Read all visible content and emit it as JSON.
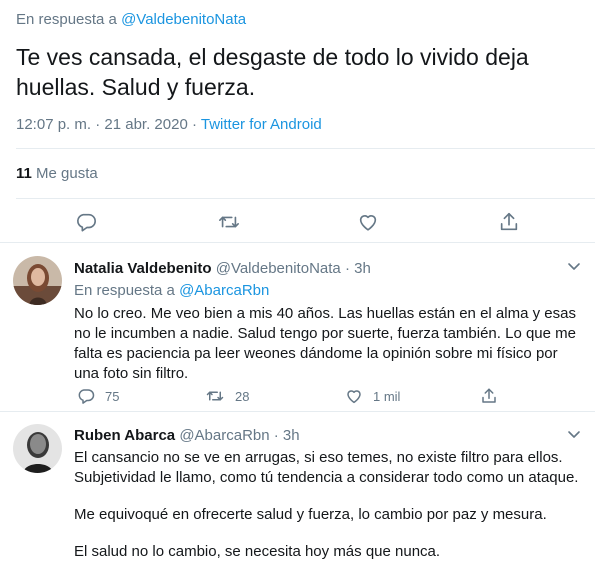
{
  "main_tweet": {
    "reply_prefix": "En respuesta a",
    "reply_handle": "@ValdebenitoNata",
    "text": "Te ves cansada, el desgaste de todo lo vivido deja huellas. Salud y fuerza.",
    "time": "12:07 p. m. · 21 abr. 2020 ·",
    "source": "Twitter for Android",
    "likes_count": "11",
    "likes_label": "Me gusta"
  },
  "replies": [
    {
      "name": "Natalia Valdebenito",
      "handle": "@ValdebenitoNata",
      "time": "· 3h",
      "reply_prefix": "En respuesta a",
      "reply_handle": "@AbarcaRbn",
      "text": "No lo creo. Me veo bien a mis 40 años. Las huellas están en el alma y esas no le incumben a nadie. Salud tengo por suerte, fuerza también. Lo que me falta es paciencia pa leer weones dándome la opinión sobre mi físico por una foto sin filtro.",
      "replies_count": "75",
      "retweets_count": "28",
      "likes_count": "1 mil"
    },
    {
      "name": "Ruben Abarca",
      "handle": "@AbarcaRbn",
      "time": "· 3h",
      "paragraph_1": "El cansancio no se ve en arrugas, si eso temes, no existe filtro para ellos. Subjetividad le llamo, como tú tendencia a considerar todo como un ataque.",
      "paragraph_2": "Me equivoqué en ofrecerte salud y fuerza, lo cambio por paz y mesura.",
      "paragraph_3": "El salud no lo cambio, se necesita hoy más que nunca."
    }
  ],
  "icons": {
    "reply": "reply-icon",
    "retweet": "retweet-icon",
    "like": "heart-icon",
    "share": "share-icon",
    "more": "chevron-down-icon"
  },
  "colors": {
    "link": "#1b95e0",
    "muted": "#657786",
    "divider": "#e6ecf0",
    "text": "#14171a"
  }
}
